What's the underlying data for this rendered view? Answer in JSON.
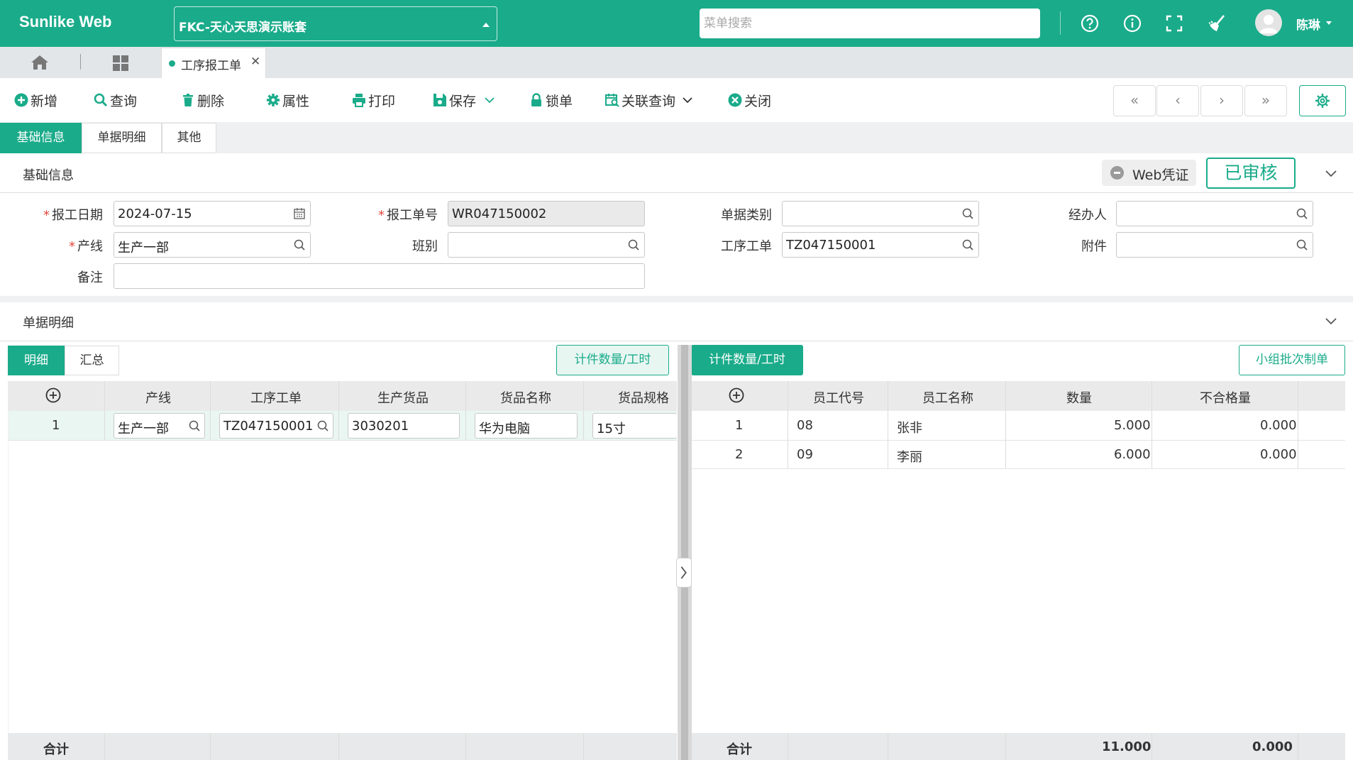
{
  "header": {
    "logo": "Sunlike Web",
    "account": "FKC-天心天思演示账套",
    "search_placeholder": "菜单搜索",
    "username": "陈琳"
  },
  "tabs": {
    "doc_tab": "工序报工单"
  },
  "toolbar": {
    "new": "新增",
    "query": "查询",
    "delete": "删除",
    "properties": "属性",
    "print": "打印",
    "save": "保存",
    "lock": "锁单",
    "related_query": "关联查询",
    "close": "关闭"
  },
  "section_tabs": [
    "基础信息",
    "单据明细",
    "其他"
  ],
  "basic": {
    "title": "基础信息",
    "web_cert": "Web凭证",
    "status": "已审核",
    "fields": {
      "report_date": {
        "label": "报工日期",
        "value": "2024-07-15"
      },
      "report_no": {
        "label": "报工单号",
        "value": "WR047150002"
      },
      "doc_type": {
        "label": "单据类别",
        "value": ""
      },
      "handler": {
        "label": "经办人",
        "value": ""
      },
      "line": {
        "label": "产线",
        "value": "生产一部"
      },
      "shift": {
        "label": "班别",
        "value": ""
      },
      "work_order": {
        "label": "工序工单",
        "value": "TZ047150001"
      },
      "attachment": {
        "label": "附件",
        "value": ""
      },
      "remark": {
        "label": "备注",
        "value": ""
      }
    }
  },
  "detail": {
    "title": "单据明细",
    "subtabs": [
      "明细",
      "汇总"
    ],
    "piece_btn_left": "计件数量/工时",
    "piece_btn_right": "计件数量/工时",
    "group_batch_btn": "小组批次制单",
    "left_grid": {
      "columns": [
        "产线",
        "工序工单",
        "生产货品",
        "货品名称",
        "货品规格"
      ],
      "rows": [
        {
          "no": "1",
          "line": "生产一部",
          "work_order": "TZ047150001",
          "product": "3030201",
          "name": "华为电脑",
          "spec": "15寸"
        }
      ],
      "total_label": "合计"
    },
    "right_grid": {
      "columns": [
        "员工代号",
        "员工名称",
        "数量",
        "不合格量"
      ],
      "rows": [
        {
          "no": "1",
          "code": "08",
          "name": "张非",
          "qty": "5.000",
          "defect": "0.000"
        },
        {
          "no": "2",
          "code": "09",
          "name": "李丽",
          "qty": "6.000",
          "defect": "0.000"
        }
      ],
      "total_label": "合计",
      "total_qty": "11.000",
      "total_defect": "0.000"
    }
  },
  "colors": {
    "brand": "#1aab8a",
    "required": "#e0483d"
  }
}
